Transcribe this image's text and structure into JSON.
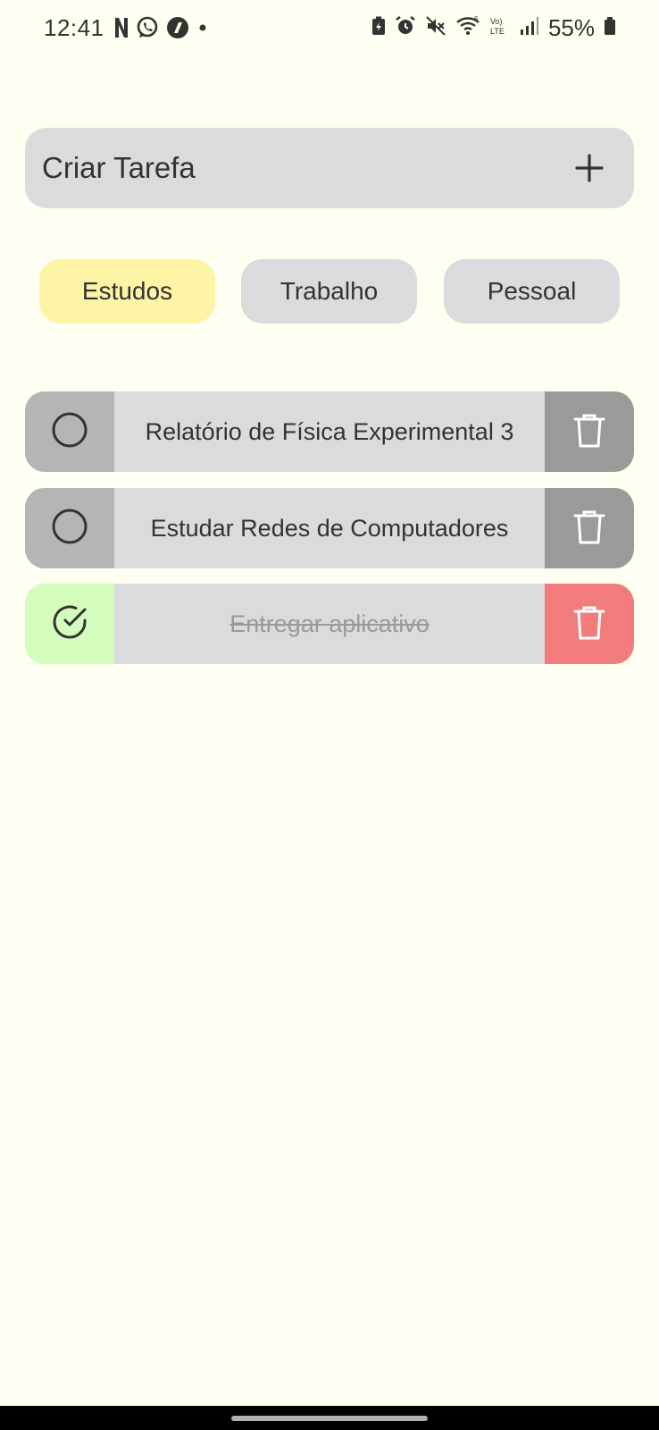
{
  "status_bar": {
    "time": "12:41",
    "left_icons": [
      "netflix-icon",
      "whatsapp-icon",
      "app-icon",
      "dot-icon"
    ],
    "right_icons": [
      "battery-saver-icon",
      "alarm-icon",
      "mute-icon",
      "wifi-icon",
      "volte-icon",
      "signal-icon"
    ],
    "battery_percent": "55%"
  },
  "create_task": {
    "label": "Criar Tarefa",
    "action_icon": "plus-icon"
  },
  "tabs": [
    {
      "label": "Estudos",
      "active": true
    },
    {
      "label": "Trabalho",
      "active": false
    },
    {
      "label": "Pessoal",
      "active": false
    }
  ],
  "tasks": [
    {
      "title": "Relatório de Física Experimental 3",
      "done": false
    },
    {
      "title": "Estudar Redes de Computadores",
      "done": false
    },
    {
      "title": "Entregar aplicativo",
      "done": true
    }
  ],
  "colors": {
    "background": "#fefef1",
    "card": "#dbdbdd",
    "active_tab": "#fdf4a5",
    "done_check": "#d4fdbd",
    "done_delete": "#f27c7c",
    "pending_check": "#b5b5b7",
    "pending_delete": "#9a9a9a"
  }
}
